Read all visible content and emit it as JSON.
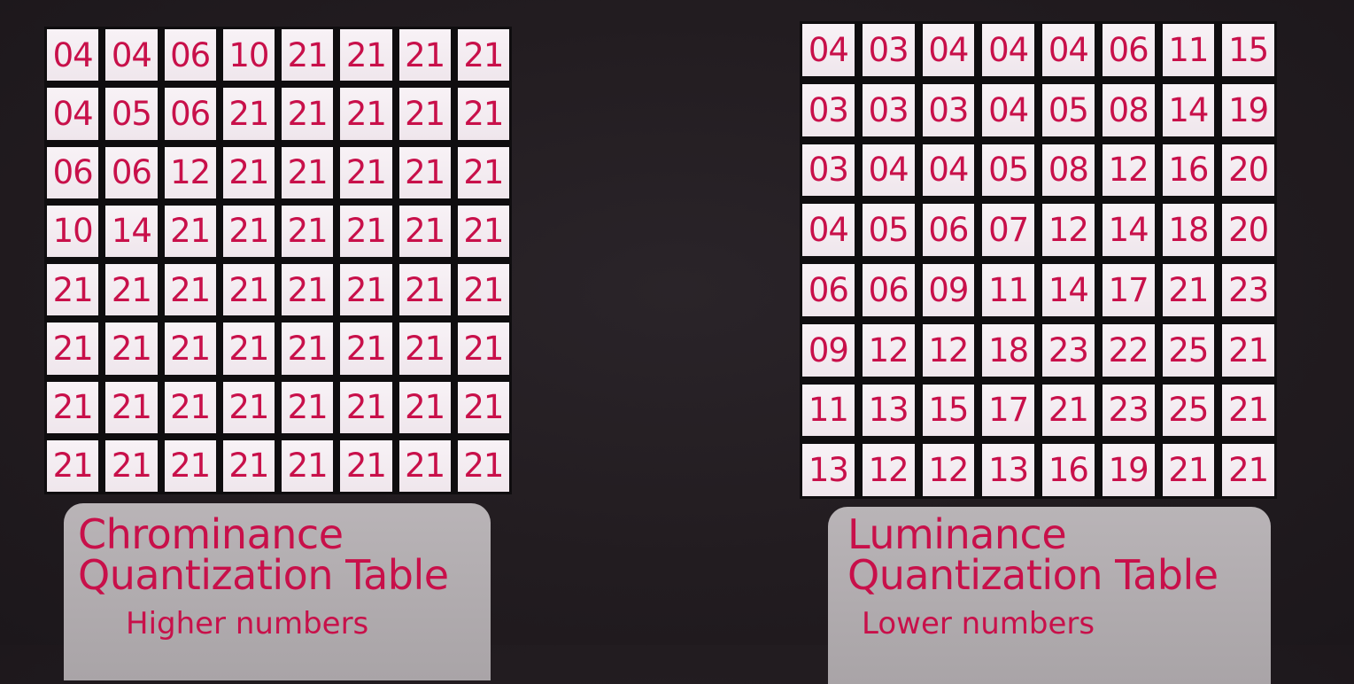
{
  "chrominance": {
    "rows": [
      [
        "04",
        "04",
        "06",
        "10",
        "21",
        "21",
        "21",
        "21"
      ],
      [
        "04",
        "05",
        "06",
        "21",
        "21",
        "21",
        "21",
        "21"
      ],
      [
        "06",
        "06",
        "12",
        "21",
        "21",
        "21",
        "21",
        "21"
      ],
      [
        "10",
        "14",
        "21",
        "21",
        "21",
        "21",
        "21",
        "21"
      ],
      [
        "21",
        "21",
        "21",
        "21",
        "21",
        "21",
        "21",
        "21"
      ],
      [
        "21",
        "21",
        "21",
        "21",
        "21",
        "21",
        "21",
        "21"
      ],
      [
        "21",
        "21",
        "21",
        "21",
        "21",
        "21",
        "21",
        "21"
      ],
      [
        "21",
        "21",
        "21",
        "21",
        "21",
        "21",
        "21",
        "21"
      ]
    ],
    "title_line1": "Chrominance",
    "title_line2": "Quantization Table",
    "subtitle": "Higher numbers"
  },
  "luminance": {
    "rows": [
      [
        "04",
        "03",
        "04",
        "04",
        "04",
        "06",
        "11",
        "15"
      ],
      [
        "03",
        "03",
        "03",
        "04",
        "05",
        "08",
        "14",
        "19"
      ],
      [
        "03",
        "04",
        "04",
        "05",
        "08",
        "12",
        "16",
        "20"
      ],
      [
        "04",
        "05",
        "06",
        "07",
        "12",
        "14",
        "18",
        "20"
      ],
      [
        "06",
        "06",
        "09",
        "11",
        "14",
        "17",
        "21",
        "23"
      ],
      [
        "09",
        "12",
        "12",
        "18",
        "23",
        "22",
        "25",
        "21"
      ],
      [
        "11",
        "13",
        "15",
        "17",
        "21",
        "23",
        "25",
        "21"
      ],
      [
        "13",
        "12",
        "12",
        "13",
        "16",
        "19",
        "21",
        "21"
      ]
    ],
    "title_line1": "Luminance",
    "title_line2": "Quantization Table",
    "subtitle": "Lower numbers"
  },
  "colors": {
    "number_text": "#c8104a",
    "cell_background": "#f4eef2",
    "caption_background": "#b3aeb1",
    "page_background": "#241e22"
  }
}
